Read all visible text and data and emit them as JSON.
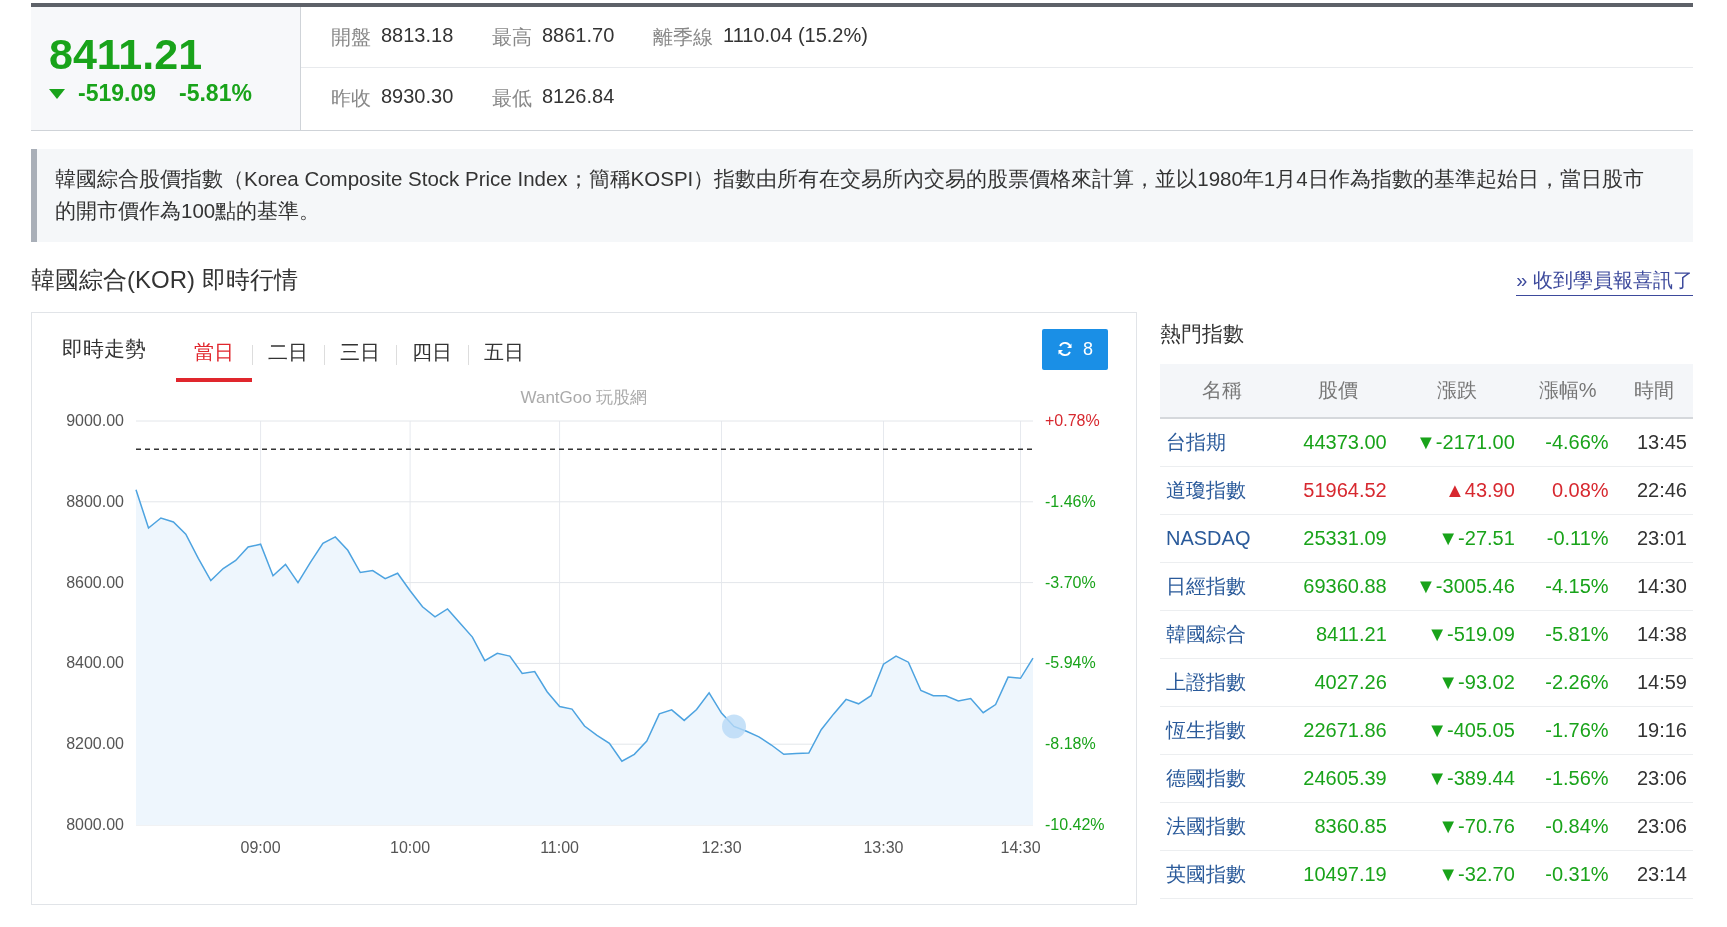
{
  "quote": {
    "price": "8411.21",
    "change": "-519.09",
    "change_pct": "-5.81%",
    "color": "#19a31a"
  },
  "stats": [
    [
      {
        "label": "開盤",
        "value": "8813.18"
      },
      {
        "label": "最高",
        "value": "8861.70"
      },
      {
        "label": "離季線",
        "value": "1110.04 (15.2%)"
      }
    ],
    [
      {
        "label": "昨收",
        "value": "8930.30"
      },
      {
        "label": "最低",
        "value": "8126.84"
      }
    ]
  ],
  "description": "韓國綜合股價指數（Korea Composite Stock Price Index；簡稱KOSPI）指數由所有在交易所內交易的股票價格來計算，並以1980年1月4日作為指數的基準起始日，當日股市的開市價作為100點的基準。",
  "section_title": "韓國綜合(KOR) 即時行情",
  "promo_link": "» 收到學員報喜訊了",
  "chart_panel": {
    "title": "即時走勢",
    "tabs": [
      {
        "label": "當日",
        "selected": true
      },
      {
        "label": "二日",
        "selected": false
      },
      {
        "label": "三日",
        "selected": false
      },
      {
        "label": "四日",
        "selected": false
      },
      {
        "label": "五日",
        "selected": false
      }
    ],
    "refresh_button": {
      "label": "8"
    },
    "watermark": "WantGoo 玩股網",
    "right_axis": [
      {
        "label": "+0.78%",
        "color": "#d7282f"
      },
      {
        "label": "-1.46%",
        "color": "#19a31a"
      },
      {
        "label": "-3.70%",
        "color": "#19a31a"
      },
      {
        "label": "-5.94%",
        "color": "#19a31a"
      },
      {
        "label": "-8.18%",
        "color": "#19a31a"
      },
      {
        "label": "-10.42%",
        "color": "#19a31a"
      }
    ],
    "chart_data": {
      "type": "area",
      "grid": true,
      "ylim": [
        8000,
        9000
      ],
      "yticks": [
        {
          "value": 9000,
          "label": "9000.00"
        },
        {
          "value": 8800,
          "label": "8800.00"
        },
        {
          "value": 8600,
          "label": "8600.00"
        },
        {
          "value": 8400,
          "label": "8400.00"
        },
        {
          "value": 8200,
          "label": "8200.00"
        },
        {
          "value": 8000,
          "label": "8000.00"
        }
      ],
      "categories": [
        null,
        null,
        null,
        null,
        null,
        null,
        null,
        null,
        null,
        null,
        "09:00",
        null,
        null,
        null,
        null,
        null,
        null,
        null,
        null,
        null,
        null,
        null,
        "10:00",
        null,
        null,
        null,
        null,
        null,
        null,
        null,
        null,
        null,
        null,
        null,
        "11:00",
        null,
        null,
        null,
        null,
        null,
        null,
        null,
        null,
        null,
        null,
        null,
        null,
        "12:30",
        null,
        null,
        null,
        null,
        null,
        null,
        null,
        null,
        null,
        null,
        null,
        null,
        "13:30",
        null,
        null,
        null,
        null,
        null,
        null,
        null,
        null,
        null,
        null,
        "14:30",
        null
      ],
      "series": [
        {
          "type": "area",
          "color": "#4da3e0",
          "values": [
            8830,
            8735,
            8760,
            8750,
            8720,
            8660,
            8605,
            8635,
            8655,
            8688,
            8695,
            8617,
            8645,
            8600,
            8650,
            8697,
            8713,
            8680,
            8625,
            8630,
            8610,
            8623,
            8580,
            8540,
            8515,
            8535,
            8500,
            8465,
            8407,
            8425,
            8418,
            8375,
            8380,
            8330,
            8293,
            8287,
            8245,
            8222,
            8202,
            8158,
            8175,
            8208,
            8275,
            8285,
            8259,
            8286,
            8327,
            8277,
            8244,
            8232,
            8218,
            8198,
            8175,
            8177,
            8178,
            8236,
            8275,
            8311,
            8300,
            8320,
            8398,
            8418,
            8403,
            8333,
            8320,
            8320,
            8307,
            8313,
            8278,
            8298,
            8366,
            8363,
            8413
          ]
        },
        {
          "type": "line",
          "line_style": "dashed",
          "color": "#333333",
          "values": [
            8930.3,
            8930.3,
            8930.3,
            8930.3,
            8930.3,
            8930.3,
            8930.3,
            8930.3,
            8930.3,
            8930.3,
            8930.3,
            8930.3,
            8930.3,
            8930.3,
            8930.3,
            8930.3,
            8930.3,
            8930.3,
            8930.3,
            8930.3,
            8930.3,
            8930.3,
            8930.3,
            8930.3,
            8930.3,
            8930.3,
            8930.3,
            8930.3,
            8930.3,
            8930.3,
            8930.3,
            8930.3,
            8930.3,
            8930.3,
            8930.3,
            8930.3,
            8930.3,
            8930.3,
            8930.3,
            8930.3,
            8930.3,
            8930.3,
            8930.3,
            8930.3,
            8930.3,
            8930.3,
            8930.3,
            8930.3,
            8930.3,
            8930.3,
            8930.3,
            8930.3,
            8930.3,
            8930.3,
            8930.3,
            8930.3,
            8930.3,
            8930.3,
            8930.3,
            8930.3,
            8930.3,
            8930.3,
            8930.3,
            8930.3,
            8930.3,
            8930.3,
            8930.3,
            8930.3,
            8930.3,
            8930.3,
            8930.3,
            8930.3,
            8930.3
          ]
        }
      ]
    }
  },
  "hot_indices": {
    "title": "熱門指數",
    "columns": [
      "名稱",
      "股價",
      "漲跌",
      "漲幅%",
      "時間"
    ],
    "rows": [
      {
        "name": "台指期",
        "price": "44373.00",
        "change": "▼-2171.00",
        "change_pct": "-4.66%",
        "time": "13:45",
        "color": "#19a31a"
      },
      {
        "name": "道瓊指數",
        "price": "51964.52",
        "change": "▲43.90",
        "change_pct": "0.08%",
        "time": "22:46",
        "color": "#d7282f"
      },
      {
        "name": "NASDAQ",
        "price": "25331.09",
        "change": "▼-27.51",
        "change_pct": "-0.11%",
        "time": "23:01",
        "color": "#19a31a"
      },
      {
        "name": "日經指數",
        "price": "69360.88",
        "change": "▼-3005.46",
        "change_pct": "-4.15%",
        "time": "14:30",
        "color": "#19a31a"
      },
      {
        "name": "韓國綜合",
        "price": "8411.21",
        "change": "▼-519.09",
        "change_pct": "-5.81%",
        "time": "14:38",
        "color": "#19a31a"
      },
      {
        "name": "上證指數",
        "price": "4027.26",
        "change": "▼-93.02",
        "change_pct": "-2.26%",
        "time": "14:59",
        "color": "#19a31a"
      },
      {
        "name": "恆生指數",
        "price": "22671.86",
        "change": "▼-405.05",
        "change_pct": "-1.76%",
        "time": "19:16",
        "color": "#19a31a"
      },
      {
        "name": "德國指數",
        "price": "24605.39",
        "change": "▼-389.44",
        "change_pct": "-1.56%",
        "time": "23:06",
        "color": "#19a31a"
      },
      {
        "name": "法國指數",
        "price": "8360.85",
        "change": "▼-70.76",
        "change_pct": "-0.84%",
        "time": "23:06",
        "color": "#19a31a"
      },
      {
        "name": "英國指數",
        "price": "10497.19",
        "change": "▼-32.70",
        "change_pct": "-0.31%",
        "time": "23:14",
        "color": "#19a31a"
      }
    ]
  }
}
